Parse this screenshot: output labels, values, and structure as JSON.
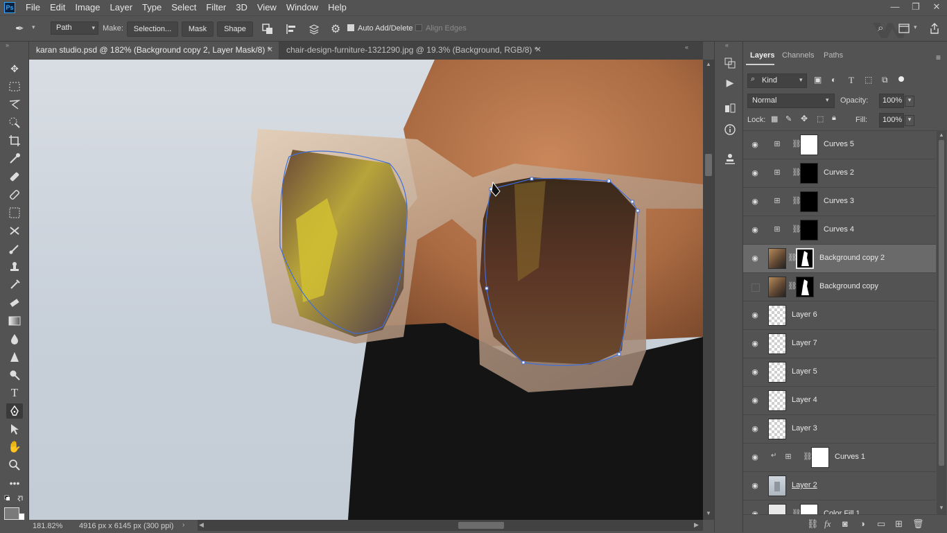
{
  "menu": [
    "File",
    "Edit",
    "Image",
    "Layer",
    "Type",
    "Select",
    "Filter",
    "3D",
    "View",
    "Window",
    "Help"
  ],
  "app_logo": "Ps",
  "window_controls": [
    "—",
    "❐",
    "✕"
  ],
  "options": {
    "mode": "Path",
    "make_label": "Make:",
    "selection_button": "Selection...",
    "mask_button": "Mask",
    "shape_button": "Shape",
    "auto_add_delete": "Auto Add/Delete",
    "auto_add_delete_checked": true,
    "align_edges": "Align Edges",
    "align_edges_checked": false
  },
  "tabs": [
    {
      "label": "karan studio.psd @ 182% (Background copy 2, Layer Mask/8) *",
      "active": true
    },
    {
      "label": "chair-design-furniture-1321290.jpg @ 19.3% (Background, RGB/8) *",
      "active": false
    }
  ],
  "status": {
    "zoom": "181.82%",
    "doc_info": "4916 px x 6145 px (300 ppi)"
  },
  "panel": {
    "tabs": [
      "Layers",
      "Channels",
      "Paths"
    ],
    "filter_kind": "Kind",
    "blend_mode": "Normal",
    "opacity_label": "Opacity:",
    "opacity_value": "100%",
    "lock_label": "Lock:",
    "fill_label": "Fill:",
    "fill_value": "100%"
  },
  "layers": [
    {
      "name": "Curves 5",
      "type": "adjustment",
      "visible": true,
      "mask": "white"
    },
    {
      "name": "Curves 2",
      "type": "adjustment",
      "visible": true,
      "mask": "black"
    },
    {
      "name": "Curves 3",
      "type": "adjustment",
      "visible": true,
      "mask": "black"
    },
    {
      "name": "Curves 4",
      "type": "adjustment",
      "visible": true,
      "mask": "black"
    },
    {
      "name": "Background copy 2",
      "type": "image",
      "visible": true,
      "selected": true
    },
    {
      "name": "Background copy",
      "type": "image",
      "visible": false
    },
    {
      "name": "Layer 6",
      "type": "pixel",
      "visible": true
    },
    {
      "name": "Layer 7",
      "type": "pixel",
      "visible": true
    },
    {
      "name": "Layer 5",
      "type": "pixel",
      "visible": true
    },
    {
      "name": "Layer 4",
      "type": "pixel",
      "visible": true
    },
    {
      "name": "Layer 3",
      "type": "pixel",
      "visible": true
    },
    {
      "name": "Curves 1",
      "type": "adjustment-clipped",
      "visible": true,
      "mask": "white"
    },
    {
      "name": "Layer 2",
      "type": "image-linked",
      "visible": true
    },
    {
      "name": "Color Fill 1",
      "type": "fill",
      "visible": true
    }
  ],
  "colors": {
    "accent": "#31a8ff",
    "path": "#3f6fd8",
    "panel_bg": "#535353"
  }
}
